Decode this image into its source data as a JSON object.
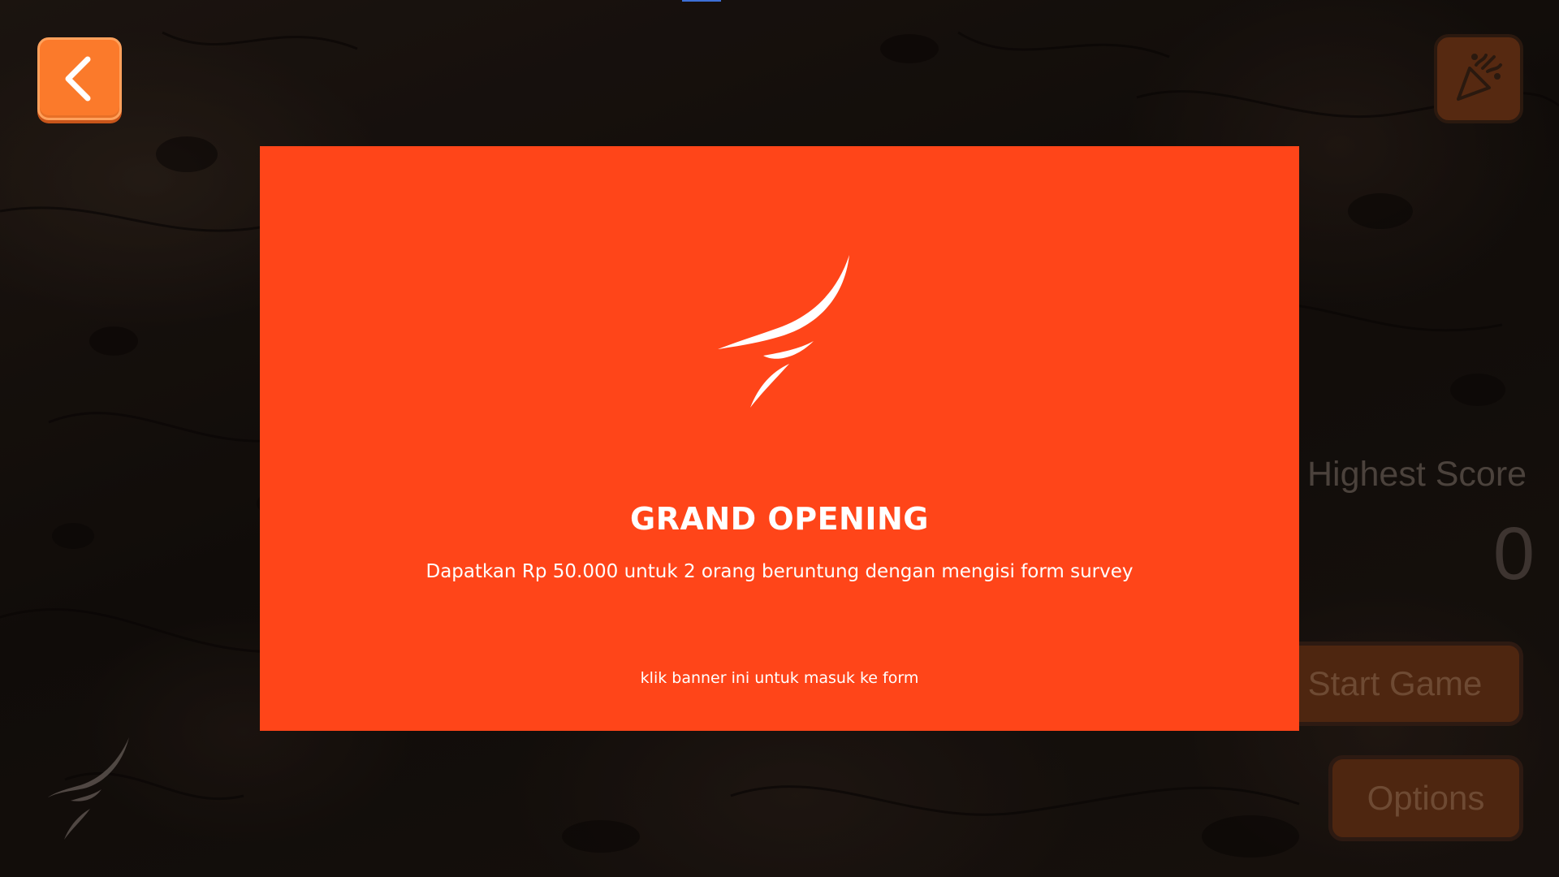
{
  "menu": {
    "highest_score_label": "Highest Score",
    "highest_score_value": "0",
    "start_label": "Start Game",
    "options_label": "Options"
  },
  "icons": {
    "back": "chevron-left-icon",
    "celebrate": "party-popper-icon",
    "logo": "claw-mark-logo"
  },
  "banner": {
    "title": "GRAND OPENING",
    "description": "Dapatkan Rp 50.000 untuk 2 orang beruntung dengan mengisi form survey",
    "cta": "klik banner ini untuk masuk ke form"
  },
  "colors": {
    "banner_bg": "#ff4519",
    "back_button": "#fb7a2b",
    "menu_button": "#4e2610"
  }
}
